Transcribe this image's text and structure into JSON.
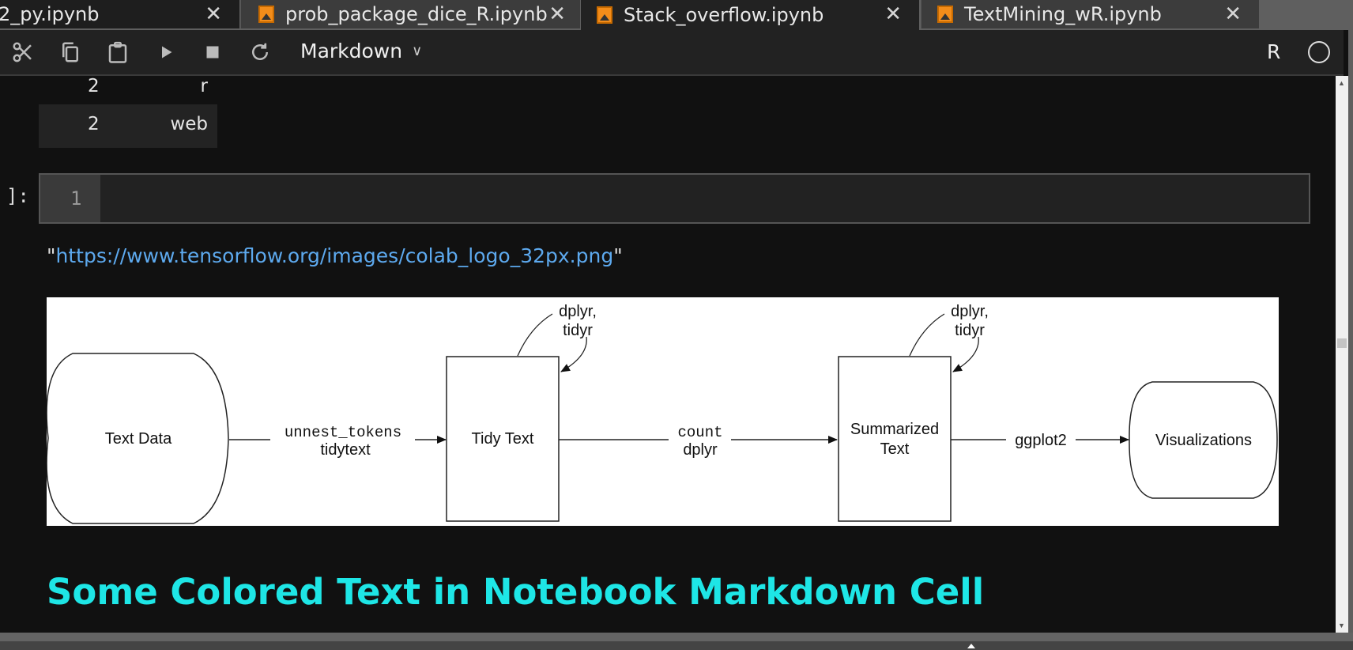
{
  "tabs": [
    {
      "label": "2_py.ipynb",
      "close": "✕",
      "active": false
    },
    {
      "label": "prob_package_dice_R.ipynb",
      "close": "✕",
      "active": false
    },
    {
      "label": "Stack_overflow.ipynb",
      "close": "✕",
      "active": true
    },
    {
      "label": "TextMining_wR.ipynb",
      "close": "✕",
      "active": false
    }
  ],
  "toolbar": {
    "icons": [
      "cut-icon",
      "copy-icon",
      "paste-icon",
      "run-icon",
      "stop-icon",
      "restart-icon"
    ],
    "cell_type": "Markdown",
    "chevron": "⌄",
    "kernel_name": "R",
    "kernel_status": "idle"
  },
  "output_table": {
    "rows": [
      {
        "n": "2",
        "word": "r"
      },
      {
        "n": "2",
        "word": "web"
      }
    ]
  },
  "code_cell": {
    "prompt": "]:",
    "line_number": "1",
    "content": ""
  },
  "markdown": {
    "url_quote_open": "\"",
    "url": "https://www.tensorflow.org/images/colab_logo_32px.png",
    "url_quote_close": "\"",
    "heading": "Some Colored Text in Notebook Markdown Cell",
    "heading_color": "#1ee6e6"
  },
  "diagram": {
    "nodes": {
      "text_data": "Text Data",
      "tidy_text": "Tidy Text",
      "summarized_1": "Summarized",
      "summarized_2": "Text",
      "visualizations": "Visualizations"
    },
    "edges": {
      "e1_code": "unnest_tokens",
      "e1_pkg": "tidytext",
      "e2_code": "count",
      "e2_pkg": "dplyr",
      "e3_pkg": "ggplot2"
    },
    "loops": {
      "l1_a": "dplyr,",
      "l1_b": "tidyr",
      "l2_a": "dplyr,",
      "l2_b": "tidyr"
    }
  }
}
